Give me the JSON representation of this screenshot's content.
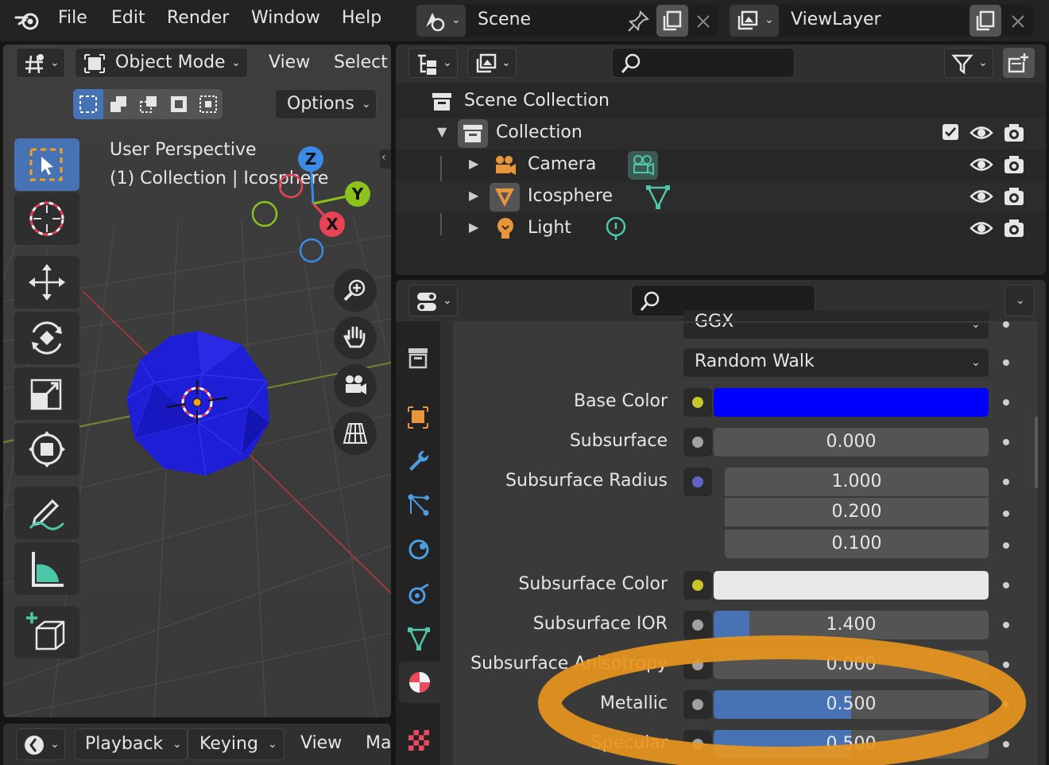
{
  "menu": {
    "items": [
      "File",
      "Edit",
      "Render",
      "Window",
      "Help"
    ]
  },
  "header": {
    "scene_label": "Scene",
    "viewlayer_label": "ViewLayer"
  },
  "viewport": {
    "mode_label": "Object Mode",
    "view_label": "View",
    "select_label": "Select",
    "options_label": "Options",
    "perspective_label": "User Perspective",
    "collection_label": "(1) Collection | Icosphere",
    "axis_z": "Z",
    "axis_y": "Y",
    "axis_x": "X",
    "object_color": "#1e1ed6"
  },
  "timeline": {
    "playback_label": "Playback",
    "keying_label": "Keying",
    "view_label": "View",
    "marker_label": "Ma"
  },
  "outliner": {
    "scene_collection": "Scene Collection",
    "collection": "Collection",
    "items": [
      {
        "name": "Camera"
      },
      {
        "name": "Icosphere"
      },
      {
        "name": "Light"
      }
    ]
  },
  "properties": {
    "dropdown_top": "GGX",
    "dropdown_subsurface": "Random Walk",
    "base_color_label": "Base Color",
    "base_color": "#0000ff",
    "subsurface_label": "Subsurface",
    "subsurface_value": "0.000",
    "subsurface_radius_label": "Subsurface Radius",
    "radius_values": [
      "1.000",
      "0.200",
      "0.100"
    ],
    "subsurface_color_label": "Subsurface Color",
    "subsurface_color": "#e8e8e8",
    "subsurface_ior_label": "Subsurface IOR",
    "subsurface_ior_value": "1.400",
    "subsurface_ior_fill": 0.13,
    "anisotropy_label": "Subsurface Anisotropy",
    "anisotropy_value": "0.000",
    "metallic_label": "Metallic",
    "metallic_value": "0.500",
    "metallic_fill": 0.5,
    "specular_label": "Specular",
    "specular_value": "0.500",
    "specular_fill": 0.5,
    "highlight_color": "#e8961e"
  }
}
